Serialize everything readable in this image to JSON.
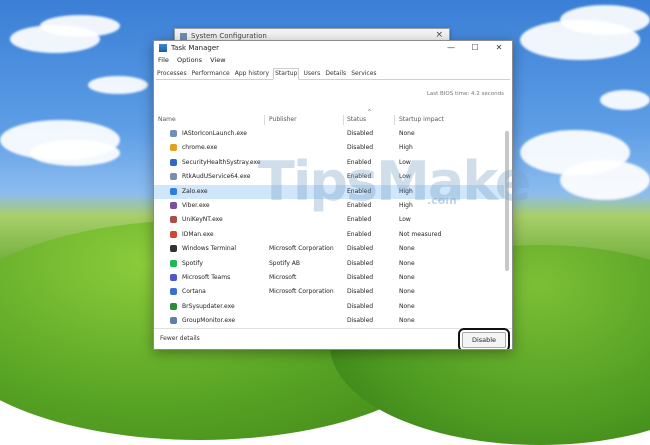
{
  "background_window": {
    "title": "System Configuration",
    "close_glyph": "×"
  },
  "task_manager": {
    "title": "Task Manager",
    "window_controls": {
      "minimize": "—",
      "maximize": "☐",
      "close": "✕"
    },
    "menu": [
      "File",
      "Options",
      "View"
    ],
    "tabs": [
      "Processes",
      "Performance",
      "App history",
      "Startup",
      "Users",
      "Details",
      "Services"
    ],
    "active_tab": "Startup",
    "last_bios_time": "Last BIOS time:  4.2 seconds",
    "sort_indicator": "^",
    "columns": {
      "name": "Name",
      "publisher": "Publisher",
      "status": "Status",
      "impact": "Startup impact"
    },
    "rows": [
      {
        "name": "IAStorIconLaunch.exe",
        "publisher": "",
        "status": "Disabled",
        "impact": "None",
        "icon": "app-icon",
        "color": "#6f8fb3"
      },
      {
        "name": "chrome.exe",
        "publisher": "",
        "status": "Disabled",
        "impact": "High",
        "icon": "chrome-icon",
        "color": "#e0a020"
      },
      {
        "name": "SecurityHealthSystray.exe",
        "publisher": "",
        "status": "Enabled",
        "impact": "Low",
        "icon": "shield-icon",
        "color": "#2f6bc6"
      },
      {
        "name": "RtkAudUService64.exe",
        "publisher": "",
        "status": "Enabled",
        "impact": "Low",
        "icon": "app-icon",
        "color": "#7a8fa8"
      },
      {
        "name": "Zalo.exe",
        "publisher": "",
        "status": "Enabled",
        "impact": "High",
        "icon": "zalo-icon",
        "color": "#2a7de1"
      },
      {
        "name": "Viber.exe",
        "publisher": "",
        "status": "Enabled",
        "impact": "High",
        "icon": "viber-icon",
        "color": "#7b519d"
      },
      {
        "name": "UniKeyNT.exe",
        "publisher": "",
        "status": "Enabled",
        "impact": "Low",
        "icon": "unikey-icon",
        "color": "#b04a4a"
      },
      {
        "name": "IDMan.exe",
        "publisher": "",
        "status": "Enabled",
        "impact": "Not measured",
        "icon": "idm-icon",
        "color": "#d0482f"
      },
      {
        "name": "Windows Terminal",
        "publisher": "Microsoft Corporation",
        "status": "Disabled",
        "impact": "None",
        "icon": "terminal-icon",
        "color": "#333333"
      },
      {
        "name": "Spotify",
        "publisher": "Spotify AB",
        "status": "Disabled",
        "impact": "None",
        "icon": "spotify-icon",
        "color": "#1db954"
      },
      {
        "name": "Microsoft Teams",
        "publisher": "Microsoft",
        "status": "Disabled",
        "impact": "None",
        "icon": "teams-icon",
        "color": "#5059c9"
      },
      {
        "name": "Cortana",
        "publisher": "Microsoft Corporation",
        "status": "Disabled",
        "impact": "None",
        "icon": "cortana-icon",
        "color": "#3a6fd1"
      },
      {
        "name": "BrSysupdater.exe",
        "publisher": "",
        "status": "Disabled",
        "impact": "None",
        "icon": "app-icon",
        "color": "#2e8b3a"
      },
      {
        "name": "GroupMonitor.exe",
        "publisher": "",
        "status": "Disabled",
        "impact": "None",
        "icon": "app-icon",
        "color": "#5f7fa6"
      }
    ],
    "selected_row_index": 4,
    "footer": {
      "fewer_details": "Fewer details",
      "disable_button": "Disable"
    }
  },
  "watermark": {
    "text": "TipsMake",
    "suffix": ".com"
  }
}
